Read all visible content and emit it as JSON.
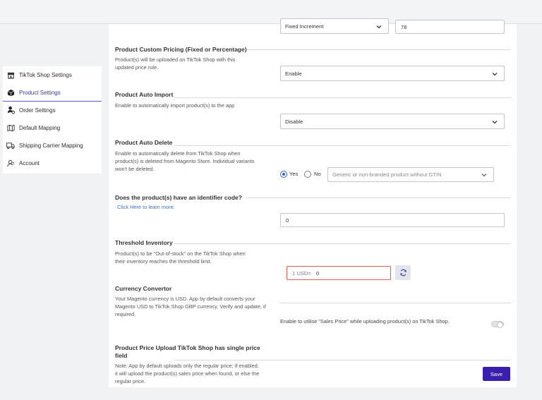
{
  "sidebar": {
    "items": [
      {
        "label": "TikTok Shop Settings",
        "icon": "store-icon"
      },
      {
        "label": "Product Settings",
        "icon": "box-icon",
        "active": true
      },
      {
        "label": "Order Settings",
        "icon": "order-user-icon"
      },
      {
        "label": "Default Mapping",
        "icon": "map-icon"
      },
      {
        "label": "Shipping Carrier Mapping",
        "icon": "truck-icon"
      },
      {
        "label": "Account",
        "icon": "user-icon"
      }
    ]
  },
  "top_row": {
    "select_value": "Fixed Increment",
    "input_value": "78"
  },
  "custom_pricing": {
    "title": "Product Custom Pricing (Fixed or Percentage)",
    "desc": "Product(s) will be uploaded on TikTok Shop with this updated price rule.",
    "select_value": "Enable"
  },
  "auto_import": {
    "title": "Product Auto Import",
    "desc": "Enable to automatically import product(s) to the app",
    "select_value": "Disable"
  },
  "auto_delete": {
    "title": "Product Auto Delete",
    "desc": "Enable to automatically delete from TikTok Shop when product(s) is deleted from Magento Store. Individual variants won't be deleted.",
    "yes_label": "Yes",
    "no_label": "No",
    "select_value": "Generic or non-branded product without GTIN"
  },
  "identifier": {
    "title": "Does the product(s) have an identifier code?",
    "link": "Click Here to learn more.",
    "input_value": "0"
  },
  "threshold": {
    "title": "Threshold Inventory",
    "desc": "Product(s) to be \"Out-of-stock\" on the TikTok Shop when their inventory reaches the threshold limit.",
    "currency_prefix": "1 USD=",
    "currency_value": "0"
  },
  "currency": {
    "title": "Currency Convertor",
    "desc": "Your Magento currency is USD. App by default converts your Magento USD to TikTok Shop GBP currency. Verify and update, if required.",
    "sales_price_text": "Enable to utilise \"Sales Price\" while uploading product(s) on TikTok Shop."
  },
  "price_upload": {
    "title": "Product Price Upload TikTok Shop has single price field",
    "desc": "Note: App by default uploads only the regular price; if enabled, it will upload the product(s) sales price when found, or else the regular price."
  },
  "save_label": "Save",
  "colors": {
    "accent": "#3a1fae",
    "active_nav": "#3b3bb0",
    "link": "#3a6fd8",
    "error_border": "#e05a4e"
  }
}
